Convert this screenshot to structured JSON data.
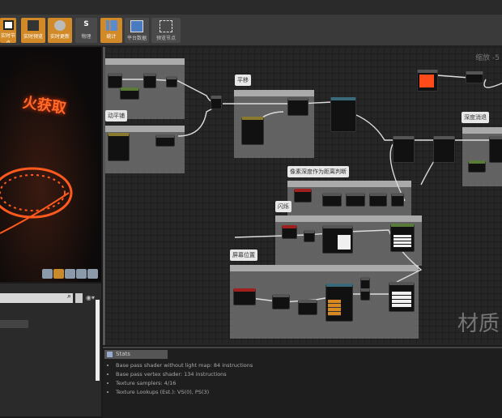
{
  "toolbar": {
    "buttons": [
      {
        "label": "实时节点",
        "active": true,
        "icon": "checkbox-icon"
      },
      {
        "label": "实时预览",
        "active": true,
        "icon": "live-preview-icon"
      },
      {
        "label": "实时更新",
        "active": true,
        "icon": "live-update-icon"
      },
      {
        "label": "物理",
        "active": false,
        "icon": "s-icon"
      },
      {
        "label": "统计",
        "active": true,
        "icon": "stats-icon"
      },
      {
        "label": "平台数据",
        "active": false,
        "icon": "platform-stats-icon"
      },
      {
        "label": "预览节点",
        "active": false,
        "icon": "nodes-icon"
      }
    ]
  },
  "viewport": {
    "overlay_text": "火获取",
    "accent": "#ff5a1e"
  },
  "graph": {
    "zoom_label": "缩放 -5",
    "watermark": "材质",
    "comments": {
      "tile": "动平铺",
      "pan": "平移",
      "depth_fade": "深度消退",
      "pixel_depth": "像素深度作为距离判断",
      "flicker": "闪烁",
      "screen_pos": "屏幕位置"
    },
    "constant_color": "#ff4a1a"
  },
  "stats": {
    "tab": "Stats",
    "lines": [
      "Base pass shader without light map: 84 instructions",
      "Base pass vertex shader: 134 instructions",
      "Texture samplers: 4/16",
      "Texture Lookups (Est.): VS(0), PS(3)"
    ]
  }
}
